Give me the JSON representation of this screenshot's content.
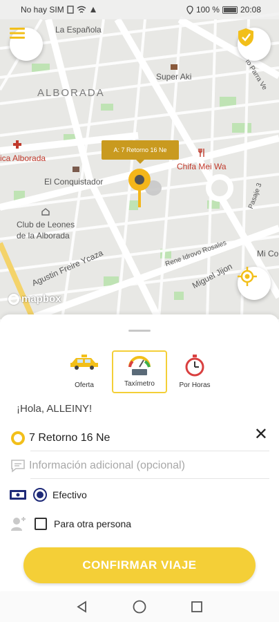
{
  "status_bar": {
    "carrier": "No hay SIM",
    "battery_percent": "100 %",
    "time": "20:08"
  },
  "map": {
    "labels": {
      "la_espanola": "La Española",
      "super_aki": "Super Aki",
      "alborada": "ALBORADA",
      "clinica": "ica Alborada",
      "chifa": "Chifa Mei Wa",
      "el_conquistador": "El Conquistador",
      "club_line1": "Club de Leones",
      "club_line2": "de la Alborada",
      "agustin": "Agustin Freire Ycaza",
      "rene": "Rene Idrovo Rosales",
      "miguel": "Miguel Jijon",
      "mi_co": "Mi Co",
      "pasaje": "Pasaje 3",
      "porto": "to Parra Ve"
    },
    "pin_bubble": "A: 7 Retorno 16 Ne",
    "attribution": "mapbox"
  },
  "sheet": {
    "modes": [
      {
        "label": "Oferta",
        "icon": "taxi-icon",
        "active": false
      },
      {
        "label": "Taxímetro",
        "icon": "taximeter-icon",
        "active": true
      },
      {
        "label": "Por Horas",
        "icon": "stopwatch-icon",
        "active": false
      }
    ],
    "greeting": "¡Hola, ALLEINY!",
    "address": "7 Retorno 16 Ne",
    "info_placeholder": "Información adicional (opcional)",
    "payment_label": "Efectivo",
    "other_person_label": "Para otra persona",
    "confirm_label": "CONFIRMAR VIAJE"
  },
  "colors": {
    "accent_yellow": "#f4cf37",
    "pin_gold": "#c99a1f",
    "radio_navy": "#1e2a78"
  }
}
